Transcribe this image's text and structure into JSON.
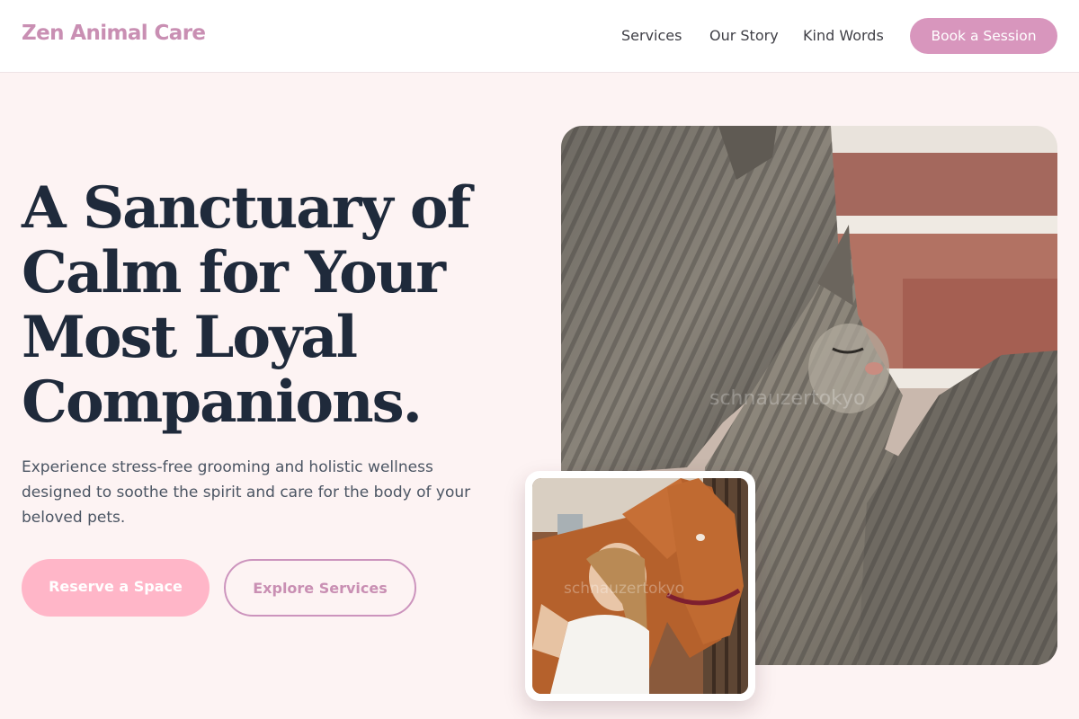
{
  "header": {
    "brand": "Zen Animal Care",
    "nav": [
      "Services",
      "Our Story",
      "Kind Words"
    ],
    "cta_label": "Book a Session"
  },
  "hero": {
    "headline_lines": [
      "A Sanctuary of",
      "Calm for Your",
      "Most Loyal",
      "Companions."
    ],
    "subtitle_lines": [
      "Experience stress-free grooming and holistic wellness",
      "designed to soothe the spirit and care for the body of your",
      "beloved pets."
    ],
    "primary_cta": "Reserve a Space",
    "secondary_cta": "Explore Services"
  },
  "images": {
    "main": {
      "subject": "two tabby cats cuddling against a brick wall",
      "watermark": "schnauzertokyo"
    },
    "inset": {
      "subject": "woman hugging a chestnut horse in a stable",
      "watermark": "schnauzertokyo"
    }
  },
  "colors": {
    "brand": "#c98fb3",
    "accent_button": "#d896bd",
    "primary_cta": "#ffb6c8",
    "headline": "#1f2a3b",
    "page_background": "#fdf3f3"
  }
}
